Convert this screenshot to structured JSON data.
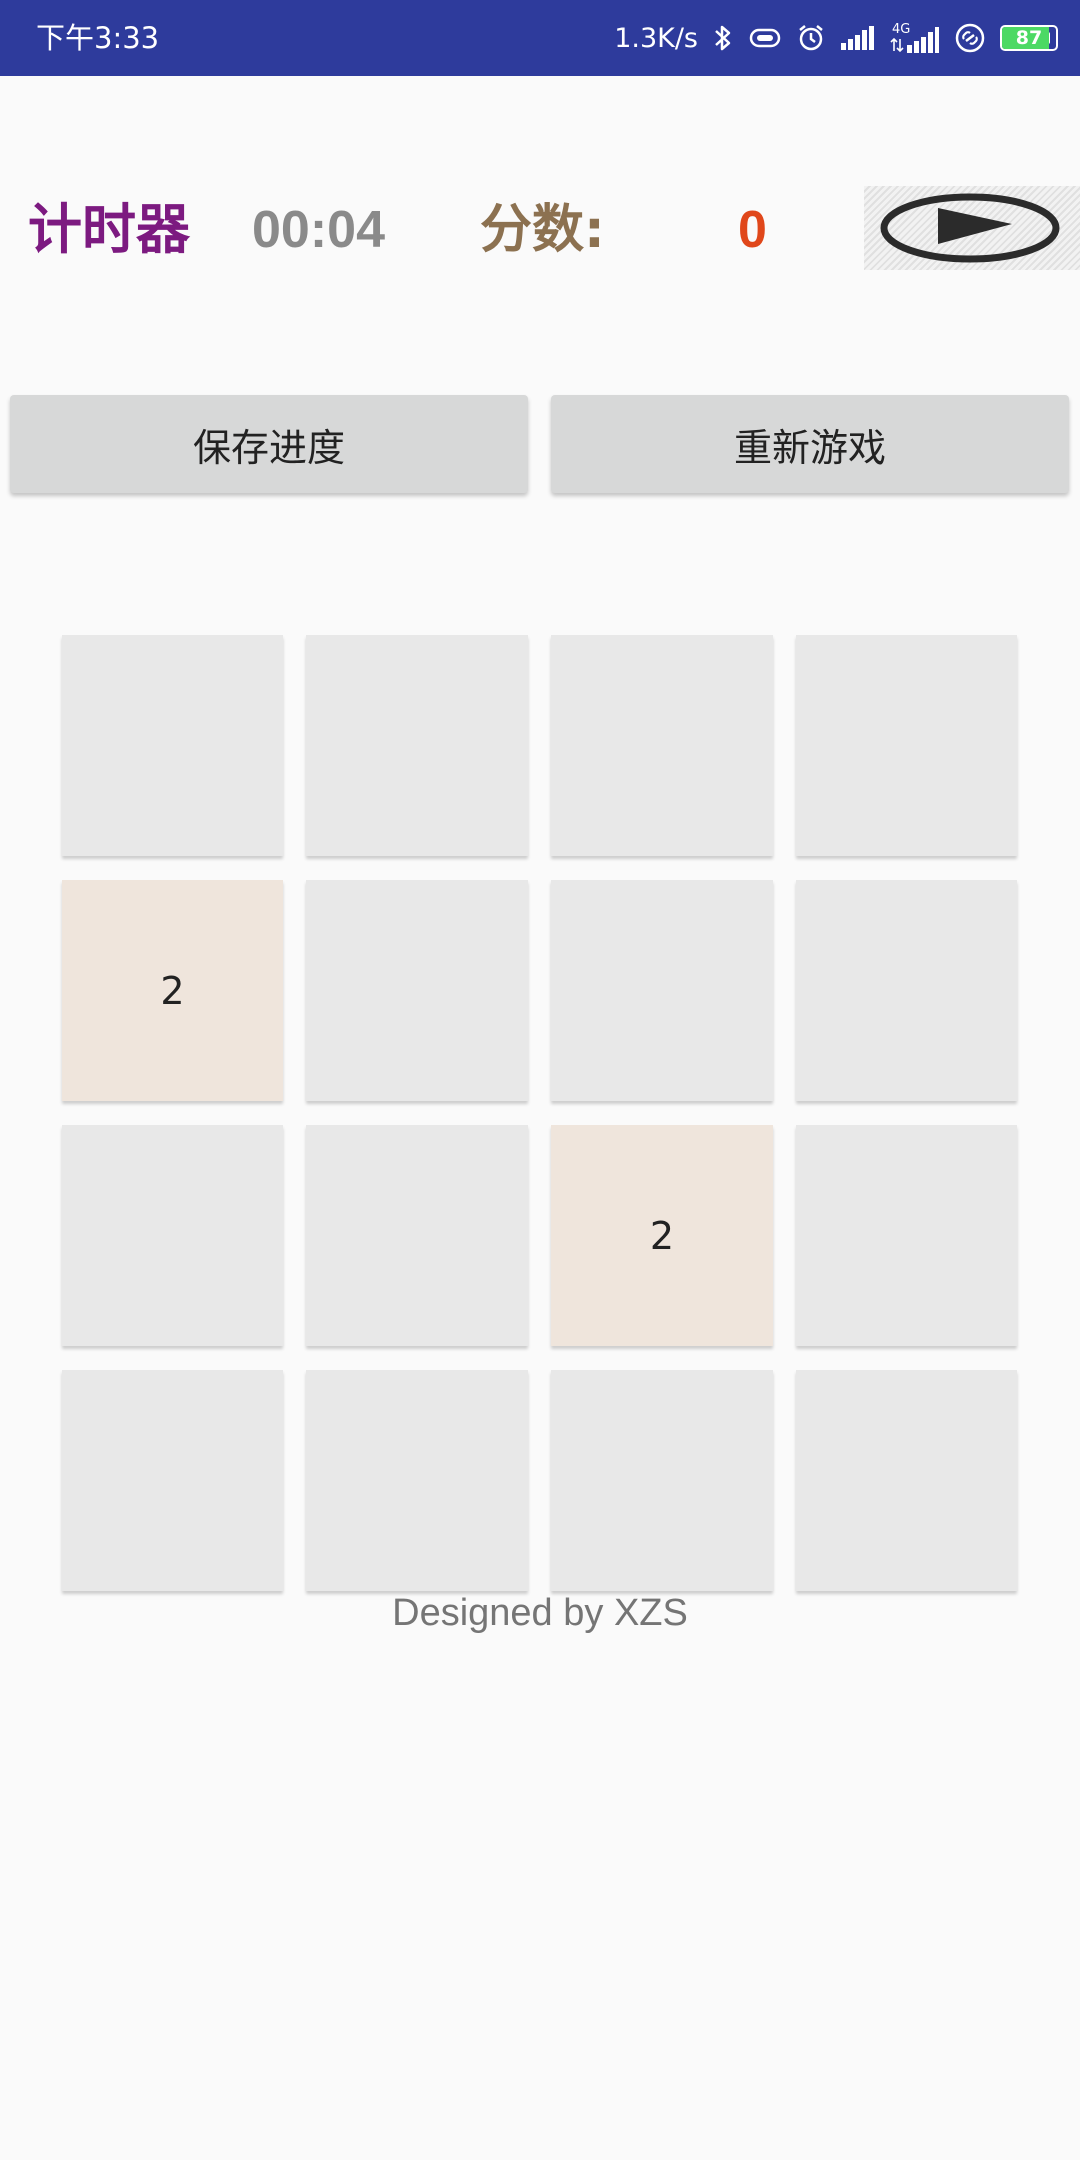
{
  "status_bar": {
    "time": "下午3:33",
    "net_speed": "1.3K/s",
    "network_type": "4G",
    "battery_level": "87",
    "battery_fraction": 0.87,
    "icons": [
      "bluetooth-icon",
      "vibrate-icon",
      "alarm-icon",
      "signal-icon",
      "signal-4g-icon",
      "link-icon",
      "battery-icon"
    ],
    "colors": {
      "background": "#2e3b9c",
      "battery_fill": "#4cd964"
    }
  },
  "header": {
    "timer_label": "计时器",
    "timer_value": "00:04",
    "score_label": "分数:",
    "score_value": "0",
    "play_icon": "play-icon",
    "colors": {
      "timer_label": "#7c1a80",
      "timer_value": "#8a8a8a",
      "score_label": "#8c7150",
      "score_value": "#e0471a"
    }
  },
  "buttons": {
    "save": "保存进度",
    "restart": "重新游戏"
  },
  "board": {
    "size": 4,
    "cells": [
      [
        "",
        "",
        "",
        ""
      ],
      [
        "2",
        "",
        "",
        ""
      ],
      [
        "",
        "",
        "2",
        ""
      ],
      [
        "",
        "",
        "",
        ""
      ]
    ],
    "colors": {
      "empty": "#e8e8e8",
      "tile_2": "#efe5dc"
    }
  },
  "footer": {
    "credit": "Designed by XZS"
  }
}
